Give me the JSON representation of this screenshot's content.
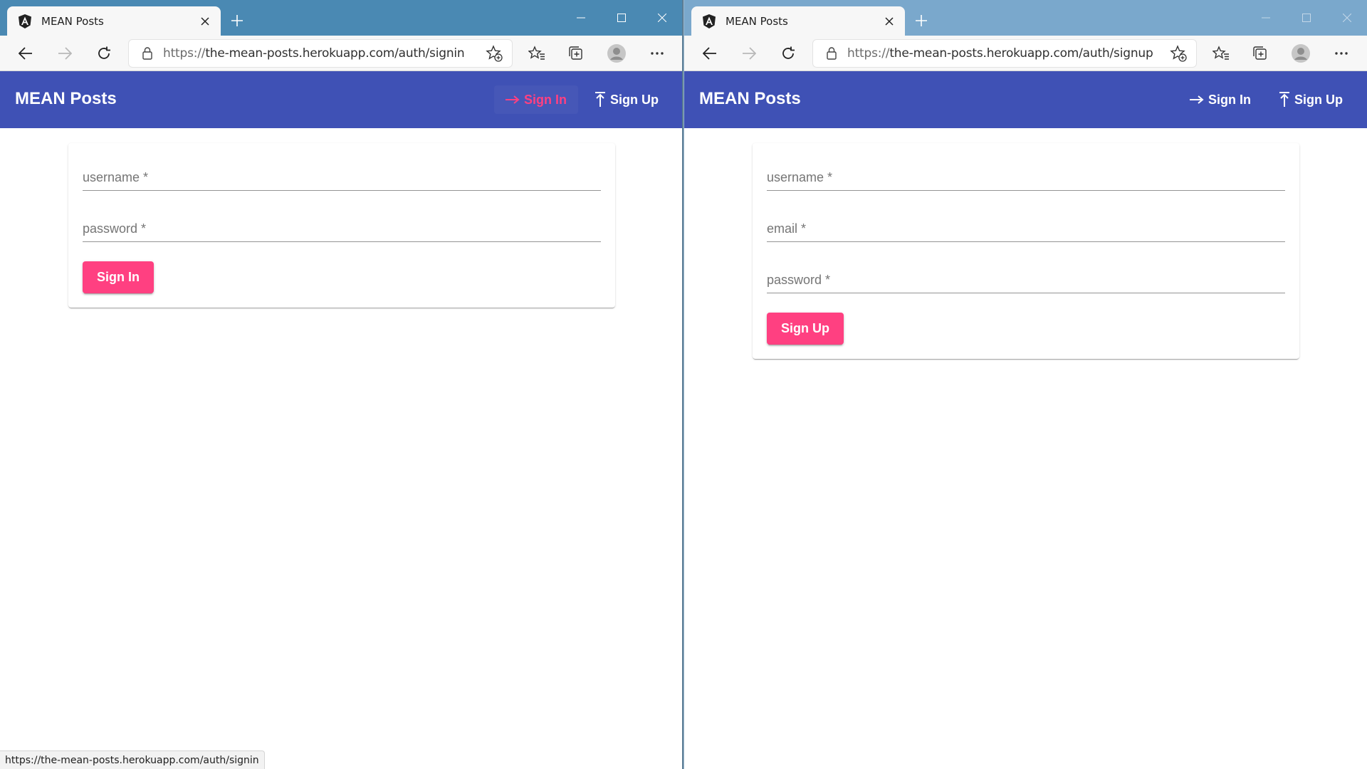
{
  "left_window": {
    "tab_title": "MEAN Posts",
    "url_scheme": "https://",
    "url_rest": "the-mean-posts.herokuapp.com/auth/signin",
    "app_title": "MEAN Posts",
    "nav": {
      "signin": "Sign In",
      "signup": "Sign Up",
      "active": "signin"
    },
    "form": {
      "fields": [
        {
          "label": "username *",
          "value": ""
        },
        {
          "label": "password *",
          "value": ""
        }
      ],
      "submit": "Sign In"
    },
    "status_url": "https://the-mean-posts.herokuapp.com/auth/signin"
  },
  "right_window": {
    "tab_title": "MEAN Posts",
    "url_scheme": "https://",
    "url_rest": "the-mean-posts.herokuapp.com/auth/signup",
    "app_title": "MEAN Posts",
    "nav": {
      "signin": "Sign In",
      "signup": "Sign Up",
      "active": ""
    },
    "form": {
      "fields": [
        {
          "label": "username *",
          "value": ""
        },
        {
          "label": "email *",
          "value": ""
        },
        {
          "label": "password *",
          "value": ""
        }
      ],
      "submit": "Sign Up"
    }
  },
  "icons": {
    "favicon": "angular-shield-icon",
    "tab_close": "close-icon",
    "new_tab": "plus-icon",
    "back": "back-arrow-icon",
    "forward": "forward-arrow-icon",
    "refresh": "refresh-icon",
    "lock": "lock-icon",
    "add_favorite": "star-plus-icon",
    "favorites": "favorites-icon",
    "collections": "collections-icon",
    "profile": "profile-avatar-icon",
    "more": "more-icon",
    "signin": "arrow-right-icon",
    "signup": "arrow-up-icon"
  },
  "colors": {
    "toolbar_primary": "#3f51b5",
    "accent": "#ff4081",
    "titlebar_active": "#4a89b3",
    "titlebar_inactive": "#7aa8cc"
  }
}
